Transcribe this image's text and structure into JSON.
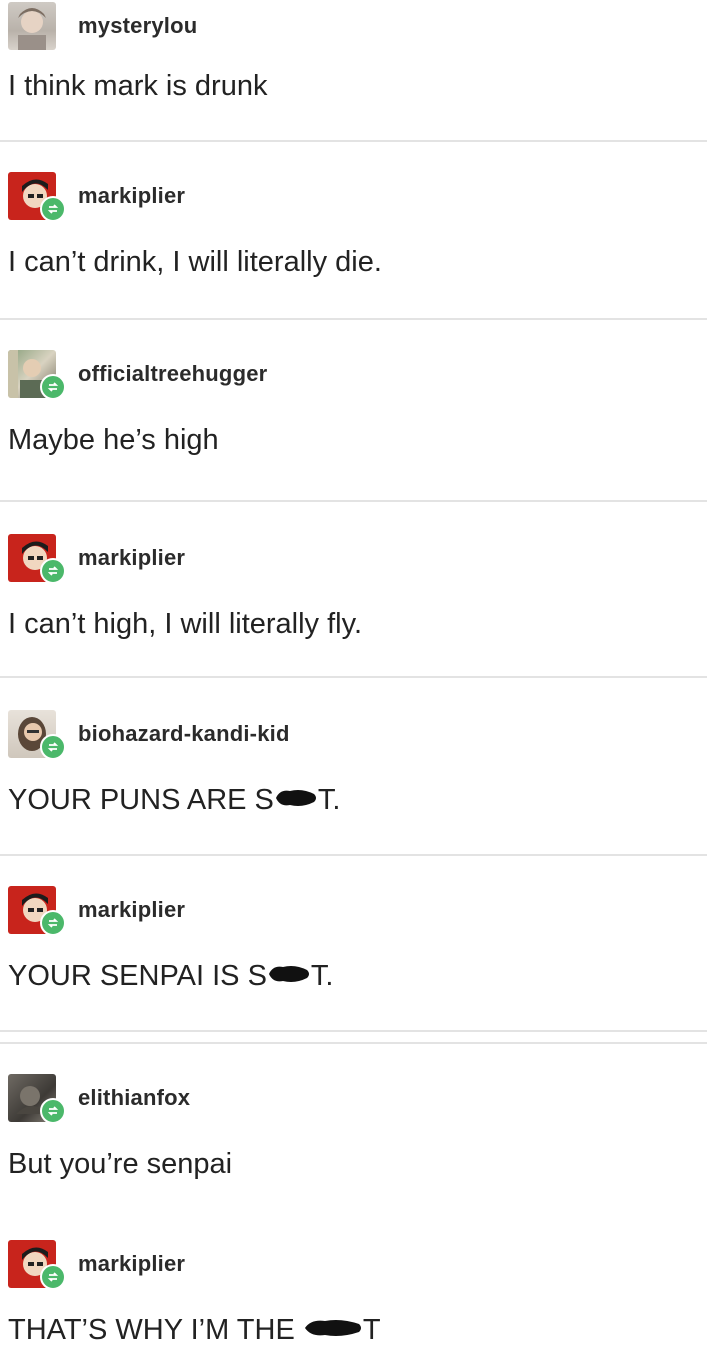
{
  "posts": [
    {
      "username": "mysterylou",
      "text": "I think mark is drunk",
      "reblog": false,
      "avatar": "mysterylou-avatar"
    },
    {
      "username": "markiplier",
      "text": "I can’t drink, I will literally die.",
      "reblog": true,
      "avatar": "markiplier-avatar"
    },
    {
      "username": "officialtreehugger",
      "text": "Maybe he’s high",
      "reblog": true,
      "avatar": "officialtreehugger-avatar"
    },
    {
      "username": "markiplier",
      "text": "I can’t high, I will literally fly.",
      "reblog": true,
      "avatar": "markiplier-avatar"
    },
    {
      "username": "biohazard-kandi-kid",
      "text_before": "YOUR PUNS ARE S",
      "text_after": "T.",
      "reblog": true,
      "avatar": "biohazard-kandi-kid-avatar"
    },
    {
      "username": "markiplier",
      "text_before": "YOUR SENPAI IS S",
      "text_after": "T.",
      "reblog": true,
      "avatar": "markiplier-avatar"
    },
    {
      "username": "elithianfox",
      "text": "But you’re senpai",
      "reblog": true,
      "avatar": "elithianfox-avatar"
    },
    {
      "username": "markiplier",
      "text_before": "THAT’S WHY I’M THE ",
      "text_after": "T",
      "reblog": true,
      "avatar": "markiplier-avatar"
    }
  ],
  "colors": {
    "reblog_badge": "#4bb86a",
    "divider": "#e3e3e3",
    "censor": "#111111"
  }
}
